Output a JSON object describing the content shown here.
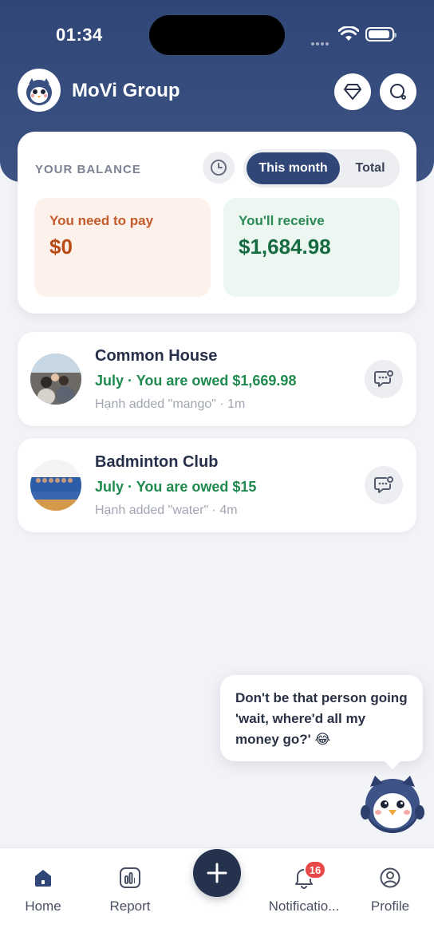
{
  "status_bar": {
    "time": "01:34"
  },
  "header": {
    "title": "MoVi Group",
    "avatar_icon": "owl-mascot-icon",
    "premium_icon": "diamond-icon",
    "search_icon": "search-icon"
  },
  "balance": {
    "label": "YOUR BALANCE",
    "history_icon": "clock-icon",
    "toggle": {
      "active": "This month",
      "inactive": "Total"
    },
    "pay": {
      "label": "You need to pay",
      "value": "$0"
    },
    "receive": {
      "label": "You'll receive",
      "value": "$1,684.98"
    }
  },
  "groups": [
    {
      "name": "Common House",
      "status": "July · You are owed $1,669.98",
      "activity": "Hạnh added \"mango\" · 1m"
    },
    {
      "name": "Badminton Club",
      "status": "July · You are owed $15",
      "activity": "Hạnh added \"water\" · 4m"
    }
  ],
  "tip": {
    "text": "Don't be that person going 'wait, where'd all my money go?' 😂"
  },
  "tabbar": {
    "home": "Home",
    "report": "Report",
    "notifications": "Notificatio...",
    "notifications_badge": "16",
    "profile": "Profile"
  },
  "colors": {
    "header": "#2f4676",
    "owed_green": "#1f8a4e",
    "pay_orange": "#b84a14",
    "badge_red": "#e84848"
  }
}
